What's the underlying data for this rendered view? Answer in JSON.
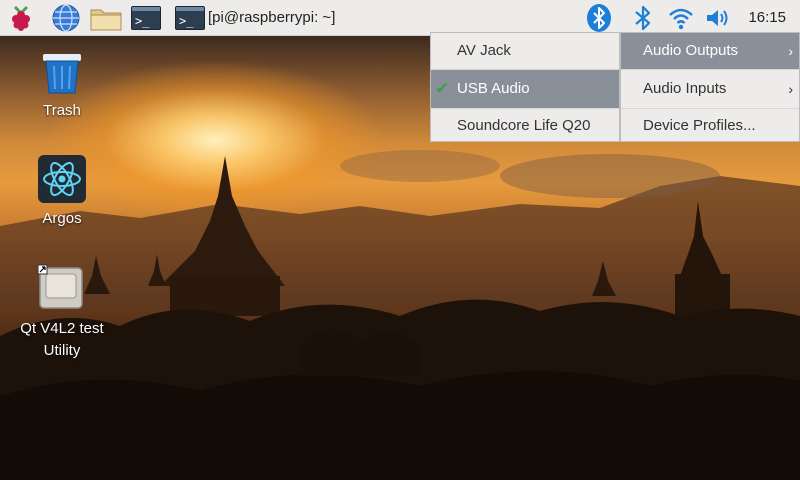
{
  "taskbar": {
    "terminal_window_title": "[pi@raspberrypi: ~]",
    "clock": "16:15",
    "icons": [
      "raspberry-menu-icon",
      "web-browser-icon",
      "file-manager-icon",
      "terminal-icon",
      "bluetooth-icon",
      "wifi-icon",
      "volume-icon"
    ]
  },
  "desktop": {
    "icons": [
      {
        "label": "Trash"
      },
      {
        "label": "Argos"
      },
      {
        "label": "Qt V4L2 test Utility"
      }
    ]
  },
  "audio_menu": {
    "items": [
      {
        "label": "Audio Outputs",
        "submenu": true,
        "selected": true
      },
      {
        "label": "Audio Inputs",
        "submenu": true
      },
      {
        "label": "Device Profiles..."
      }
    ],
    "chevron": "›"
  },
  "outputs_submenu": {
    "items": [
      {
        "label": "AV Jack"
      },
      {
        "label": "USB Audio",
        "checked": true,
        "selected": true
      },
      {
        "label": "Soundcore Life Q20"
      }
    ],
    "checkmark": "✔"
  },
  "colors": {
    "taskbar_bg": "#edeceb",
    "menu_highlight": "#8a9099",
    "check_green": "#3aa14a",
    "bluetooth_blue": "#1e7fd6"
  }
}
